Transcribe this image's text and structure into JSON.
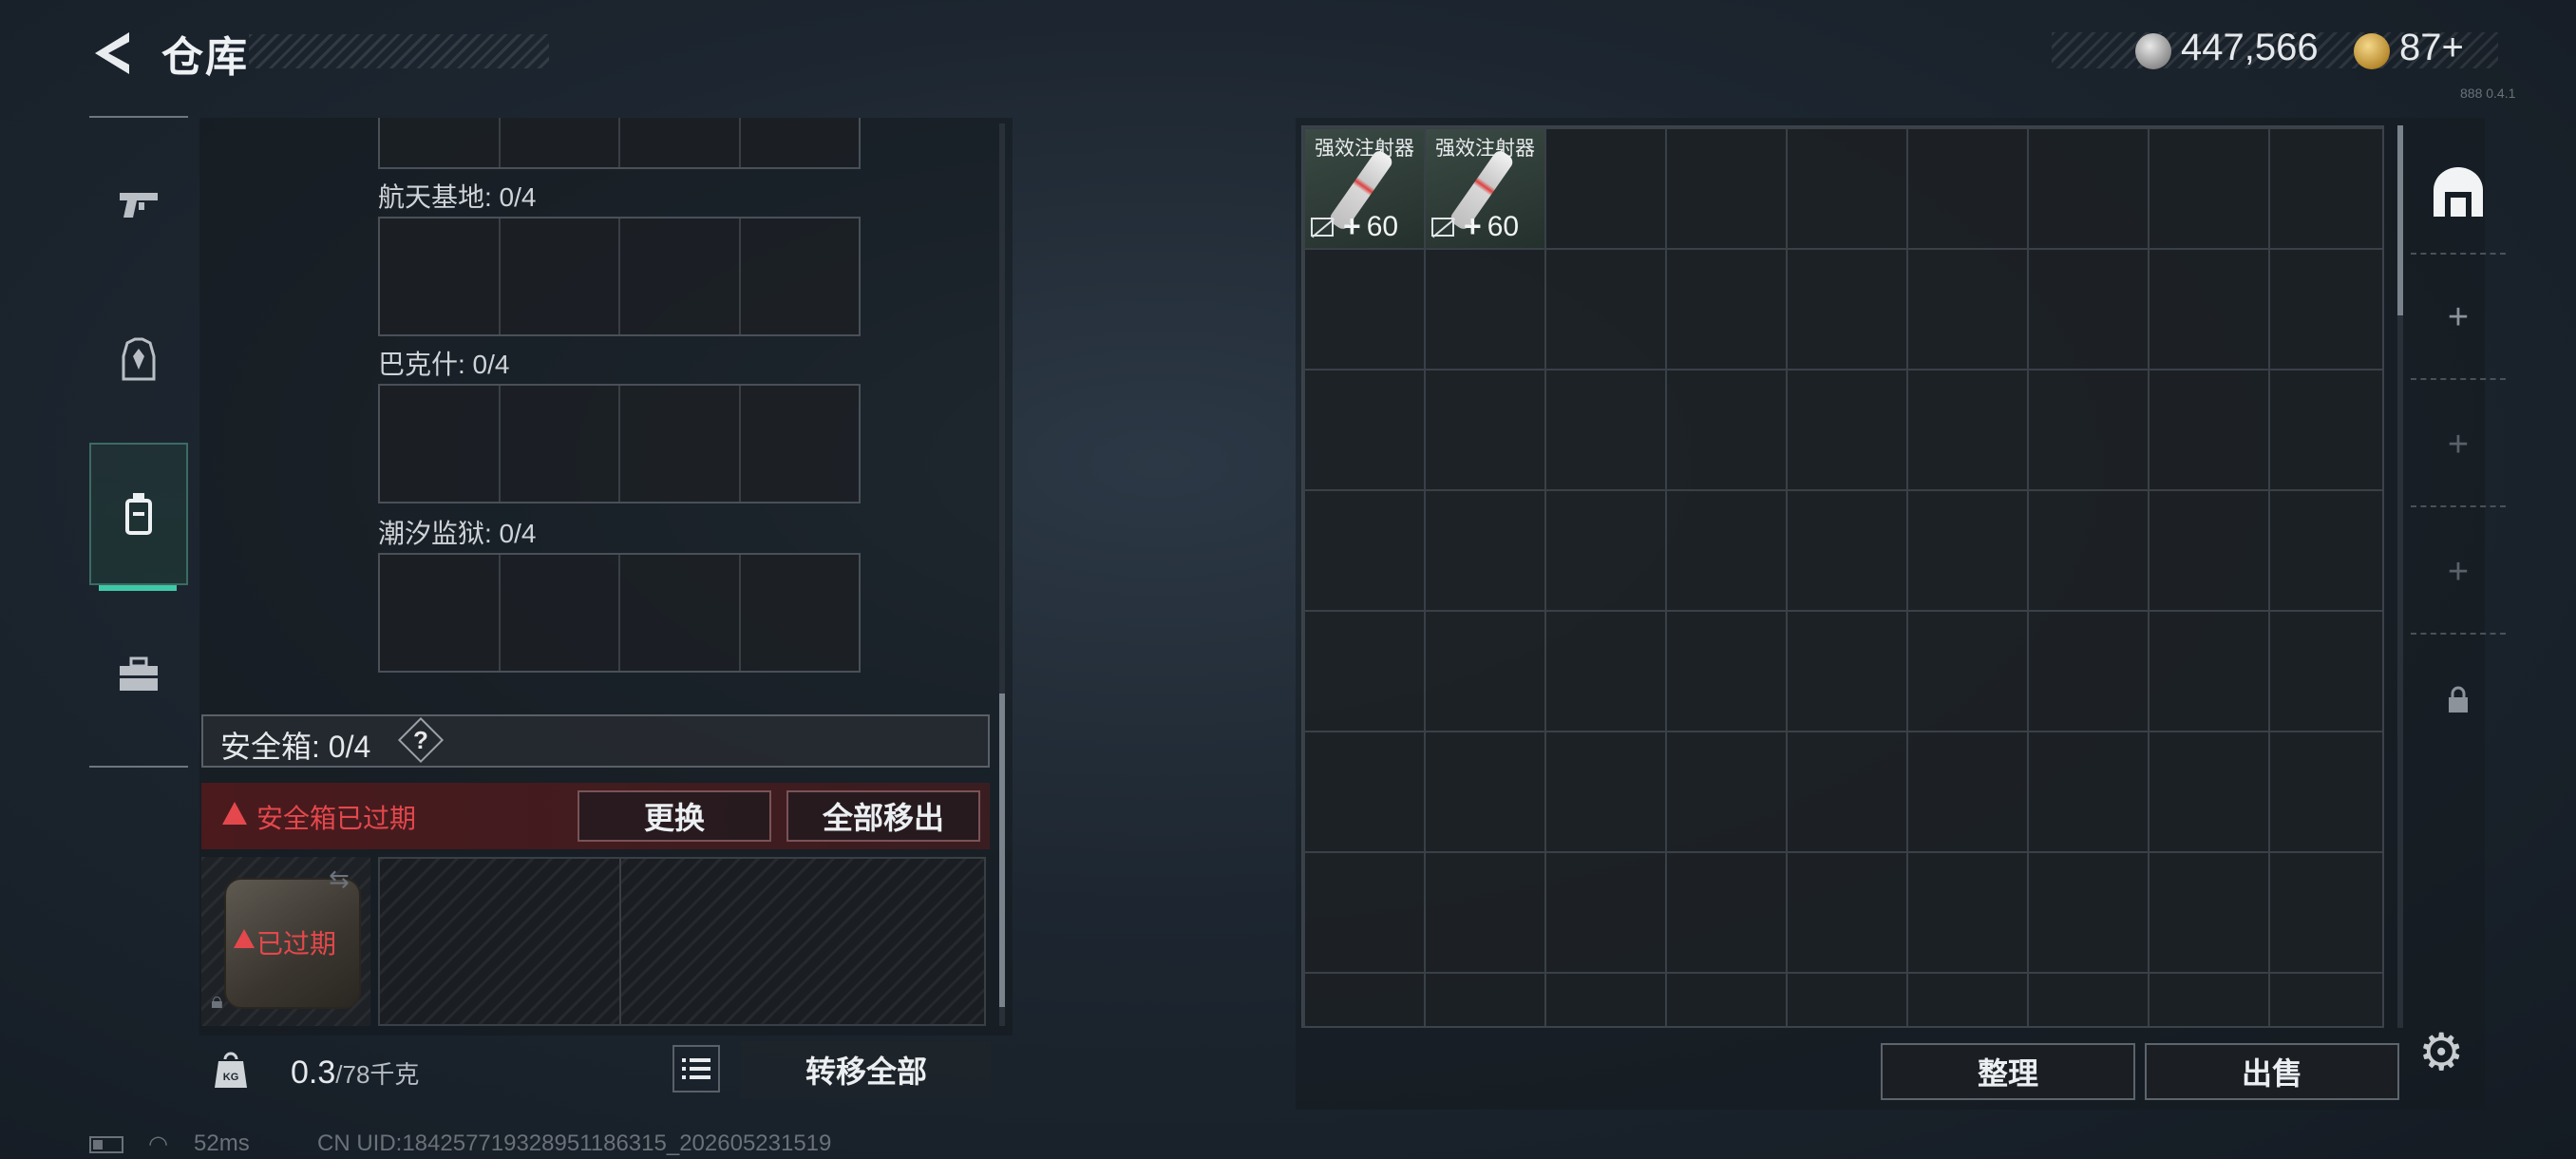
{
  "header": {
    "title": "仓库",
    "currency_primary": "447,566",
    "currency_secondary": "87+",
    "corner_tag": "888 0.4.1"
  },
  "left_nav": {
    "items": [
      "weapons-tab",
      "armor-tab",
      "backpack-tab",
      "toolbox-tab"
    ],
    "active": "backpack-tab"
  },
  "storage": {
    "sections": [
      {
        "label": "航天基地: 0/4"
      },
      {
        "label": "巴克什: 0/4"
      },
      {
        "label": "潮汐监狱: 0/4"
      }
    ],
    "safebox_label": "安全箱: 0/4",
    "help": "?",
    "expired_warning": "安全箱已过期",
    "replace_button": "更换",
    "remove_all_button": "全部移出",
    "case_expired": "已过期"
  },
  "weight": {
    "current": "0.3",
    "max": "/78千克",
    "transfer_all": "转移全部"
  },
  "status": {
    "ping": "52ms",
    "uid": "CN UID:184257719328951186315_202605231519"
  },
  "inventory": {
    "items": [
      {
        "name": "强效注射器",
        "value": "60"
      },
      {
        "name": "强效注射器",
        "value": "60"
      }
    ],
    "sort_button": "整理",
    "sell_button": "出售"
  },
  "colors": {
    "accent": "#3fc9a8",
    "danger": "#e4484c"
  }
}
